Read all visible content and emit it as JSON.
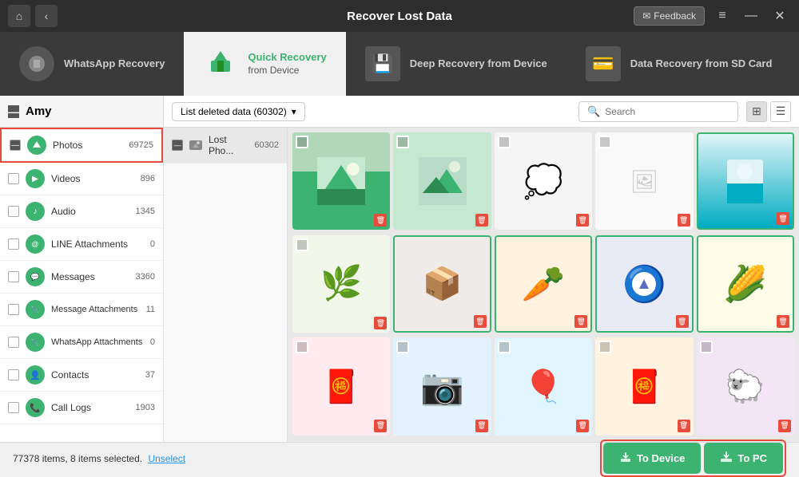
{
  "titleBar": {
    "title": "Recover Lost Data",
    "feedbackLabel": "Feedback",
    "nav": {
      "homeIcon": "⌂",
      "backIcon": "‹"
    },
    "windowControls": {
      "menu": "≡",
      "minimize": "—",
      "close": "✕"
    }
  },
  "tabs": [
    {
      "id": "whatsapp",
      "label": "WhatsApp Recovery",
      "icon": "📱",
      "active": false
    },
    {
      "id": "quick",
      "label": "Quick Recovery from Device",
      "icon": "🟢",
      "active": true
    },
    {
      "id": "deep",
      "label": "Deep Recovery from Device",
      "icon": "💾",
      "active": false
    },
    {
      "id": "sdcard",
      "label": "Data Recovery from SD Card",
      "icon": "💳",
      "active": false
    }
  ],
  "sidebar": {
    "userName": "Amy",
    "items": [
      {
        "id": "photos",
        "name": "Photos",
        "count": "69725",
        "icon": "🏔",
        "selected": true,
        "checked": "minus"
      },
      {
        "id": "videos",
        "name": "Videos",
        "count": "896",
        "icon": "▶",
        "selected": false
      },
      {
        "id": "audio",
        "name": "Audio",
        "count": "1345",
        "icon": "🎵",
        "selected": false
      },
      {
        "id": "line",
        "name": "LINE Attachments",
        "count": "0",
        "icon": "💬",
        "selected": false
      },
      {
        "id": "messages",
        "name": "Messages",
        "count": "3360",
        "icon": "💬",
        "selected": false
      },
      {
        "id": "msgattach",
        "name": "Message Attachments",
        "count": "11",
        "icon": "📎",
        "selected": false
      },
      {
        "id": "waattach",
        "name": "WhatsApp Attachments",
        "count": "0",
        "icon": "📎",
        "selected": false
      },
      {
        "id": "contacts",
        "name": "Contacts",
        "count": "37",
        "icon": "👤",
        "selected": false
      },
      {
        "id": "calllogs",
        "name": "Call Logs",
        "count": "1903",
        "icon": "📞",
        "selected": false
      }
    ]
  },
  "contentToolbar": {
    "dropdownLabel": "List deleted data (60302)",
    "searchPlaceholder": "Search"
  },
  "subSidebar": {
    "items": [
      {
        "name": "Lost Pho...",
        "count": "60302"
      }
    ]
  },
  "photos": [
    {
      "id": 1,
      "bg": "mountains",
      "emoji": "🏔",
      "selected": false
    },
    {
      "id": 2,
      "bg": "mountains2",
      "emoji": "🏔",
      "selected": false
    },
    {
      "id": 3,
      "bg": "speech",
      "emoji": "💭",
      "selected": false
    },
    {
      "id": 4,
      "bg": "sketch",
      "emoji": "📝",
      "selected": false
    },
    {
      "id": 5,
      "bg": "teal",
      "emoji": "🌊",
      "selected": true
    },
    {
      "id": 6,
      "bg": "greens",
      "emoji": "🌿",
      "selected": false
    },
    {
      "id": 7,
      "bg": "box",
      "emoji": "📦",
      "selected": true
    },
    {
      "id": 8,
      "bg": "carrot",
      "emoji": "🥕",
      "selected": true
    },
    {
      "id": 9,
      "bg": "ball",
      "emoji": "🔵",
      "selected": true
    },
    {
      "id": 10,
      "bg": "corn",
      "emoji": "🌽",
      "selected": true
    },
    {
      "id": 11,
      "bg": "envelope",
      "emoji": "💴",
      "selected": false
    },
    {
      "id": 12,
      "bg": "camera",
      "emoji": "📷",
      "selected": false
    },
    {
      "id": 13,
      "bg": "balloon",
      "emoji": "🎈",
      "selected": false
    },
    {
      "id": 14,
      "bg": "redenv",
      "emoji": "💴",
      "selected": false
    },
    {
      "id": 15,
      "bg": "sheep",
      "emoji": "🐑",
      "selected": false
    }
  ],
  "bottomBar": {
    "statusText": "77378 items, 8 items selected.",
    "unselectLabel": "Unselect",
    "toDeviceLabel": "To Device",
    "toPcLabel": "To PC"
  }
}
